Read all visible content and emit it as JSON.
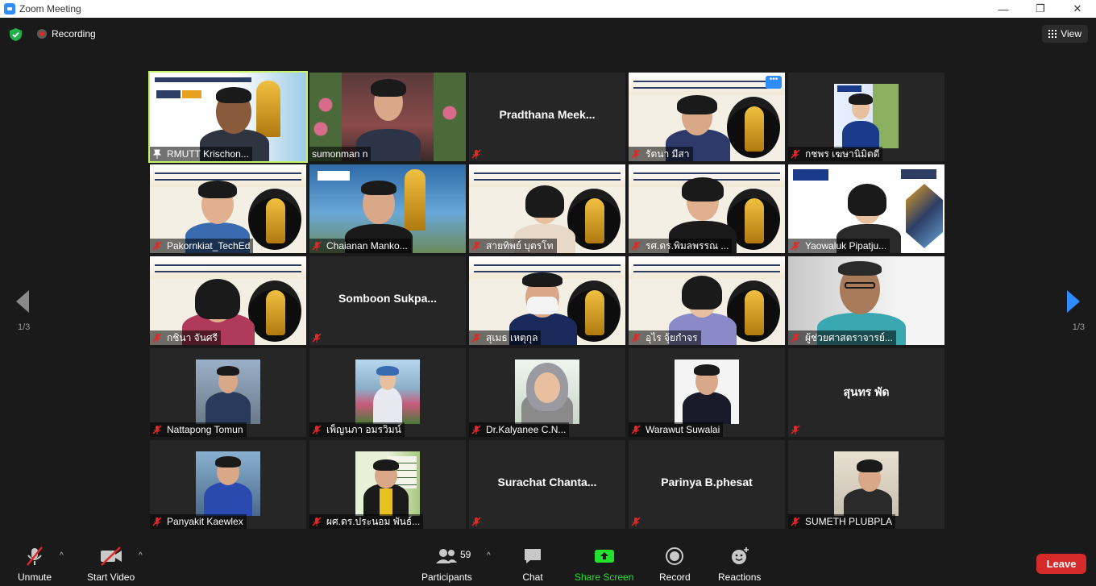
{
  "window": {
    "title": "Zoom Meeting",
    "minimize": "—",
    "restore": "❐",
    "close": "✕"
  },
  "topbar": {
    "recording_label": "Recording",
    "view_label": "View"
  },
  "pager": {
    "left": "1/3",
    "right": "1/3"
  },
  "tiles": [
    {
      "name": "RMUTT Krischon...",
      "type": "video",
      "active": true,
      "pinned": true
    },
    {
      "name": "sumonman n",
      "type": "video"
    },
    {
      "name": "",
      "display_name": "Pradthana Meek...",
      "type": "name-only",
      "muted": true
    },
    {
      "name": "รัตนา มีสา",
      "type": "video",
      "muted": true
    },
    {
      "name": "กชพร เฆษานิมิตดี",
      "type": "photo",
      "muted": true
    },
    {
      "name": "Pakornkiat_TechEd",
      "type": "video",
      "muted": true
    },
    {
      "name": "Chaianan Manko...",
      "type": "video",
      "muted": true
    },
    {
      "name": "สายทิพย์ บุตรโท",
      "type": "video",
      "muted": true
    },
    {
      "name": "รศ.ดร.พิมลพรรณ ...",
      "type": "video",
      "muted": true
    },
    {
      "name": "Yaowaluk Pipatju...",
      "type": "video",
      "muted": true
    },
    {
      "name": "กชินา จันศรี",
      "type": "video",
      "muted": true
    },
    {
      "name": "",
      "display_name": "Somboon Sukpa...",
      "type": "name-only",
      "muted": true
    },
    {
      "name": "สุเมธ เหตุกุล",
      "type": "video",
      "muted": true
    },
    {
      "name": "อุไร จุ้ยกำจร",
      "type": "video",
      "muted": true
    },
    {
      "name": "ผู้ช่วยศาสตราจารย์...",
      "type": "video",
      "muted": true
    },
    {
      "name": "Nattapong Tomun",
      "type": "photo",
      "muted": true
    },
    {
      "name": "เพ็ญนภา อมรวิมน์",
      "type": "photo",
      "muted": true
    },
    {
      "name": "Dr.Kalyanee C.N...",
      "type": "photo",
      "muted": true
    },
    {
      "name": "Warawut Suwalai",
      "type": "photo",
      "muted": true
    },
    {
      "name": "",
      "display_name": "สุนทร พัด",
      "type": "name-only",
      "muted": true
    },
    {
      "name": "Panyakit Kaewlex",
      "type": "photo",
      "muted": true
    },
    {
      "name": "ผศ.ดร.ประนอม พันธ์...",
      "type": "photo",
      "muted": true
    },
    {
      "name": "",
      "display_name": "Surachat Chanta...",
      "type": "name-only",
      "muted": true
    },
    {
      "name": "",
      "display_name": "Parinya B.phesat",
      "type": "name-only",
      "muted": true
    },
    {
      "name": "SUMETH PLUBPLA",
      "type": "photo",
      "muted": true
    }
  ],
  "toolbar": {
    "unmute": "Unmute",
    "start_video": "Start Video",
    "participants": "Participants",
    "participants_count": "59",
    "chat": "Chat",
    "share_screen": "Share Screen",
    "record": "Record",
    "reactions": "Reactions",
    "leave": "Leave"
  },
  "colors": {
    "accent": "#2d8cff",
    "share_green": "#24e02f",
    "leave_red": "#d42a2a",
    "active_speaker": "#c7f26b"
  }
}
